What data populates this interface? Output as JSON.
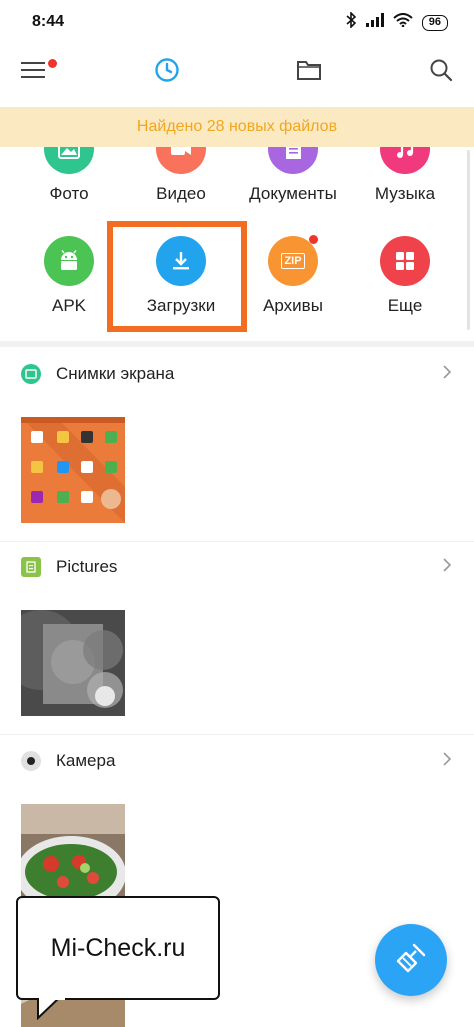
{
  "status_bar": {
    "time": "8:44",
    "battery": "96"
  },
  "top_bar": {
    "menu_icon": "menu-icon",
    "recent_icon": "clock-icon",
    "folder_icon": "folder-icon",
    "search_icon": "search-icon"
  },
  "banner": {
    "text": "Найдено 28 новых файлов"
  },
  "categories": [
    {
      "label": "Фото",
      "color": "#2fc58e",
      "icon": "image-icon"
    },
    {
      "label": "Видео",
      "color": "#f8725c",
      "icon": "video-icon"
    },
    {
      "label": "Документы",
      "color": "#a866e0",
      "icon": "document-icon"
    },
    {
      "label": "Музыка",
      "color": "#f1397e",
      "icon": "music-icon"
    },
    {
      "label": "APK",
      "color": "#4cc454",
      "icon": "android-icon"
    },
    {
      "label": "Загрузки",
      "color": "#22a3ee",
      "icon": "download-icon"
    },
    {
      "label": "Архивы",
      "color": "#f89432",
      "icon": "zip-icon",
      "badge_text": "ZIP"
    },
    {
      "label": "Еще",
      "color": "#f0424a",
      "icon": "grid-icon"
    }
  ],
  "sections": [
    {
      "title": "Снимки экрана",
      "icon_color": "#2fc58e",
      "icon": "screenshot-icon"
    },
    {
      "title": "Pictures",
      "icon_color": "#8bc34a",
      "icon": "folder-doc-icon"
    },
    {
      "title": "Камера",
      "icon_color": "#e0e0e0",
      "icon": "camera-icon"
    }
  ],
  "watermark": {
    "text": "Mi-Check.ru"
  },
  "colors": {
    "accent": "#2ca4f6",
    "banner_bg": "#fbe9c2",
    "banner_text": "#f2a71e",
    "highlight": "#f26d21"
  }
}
